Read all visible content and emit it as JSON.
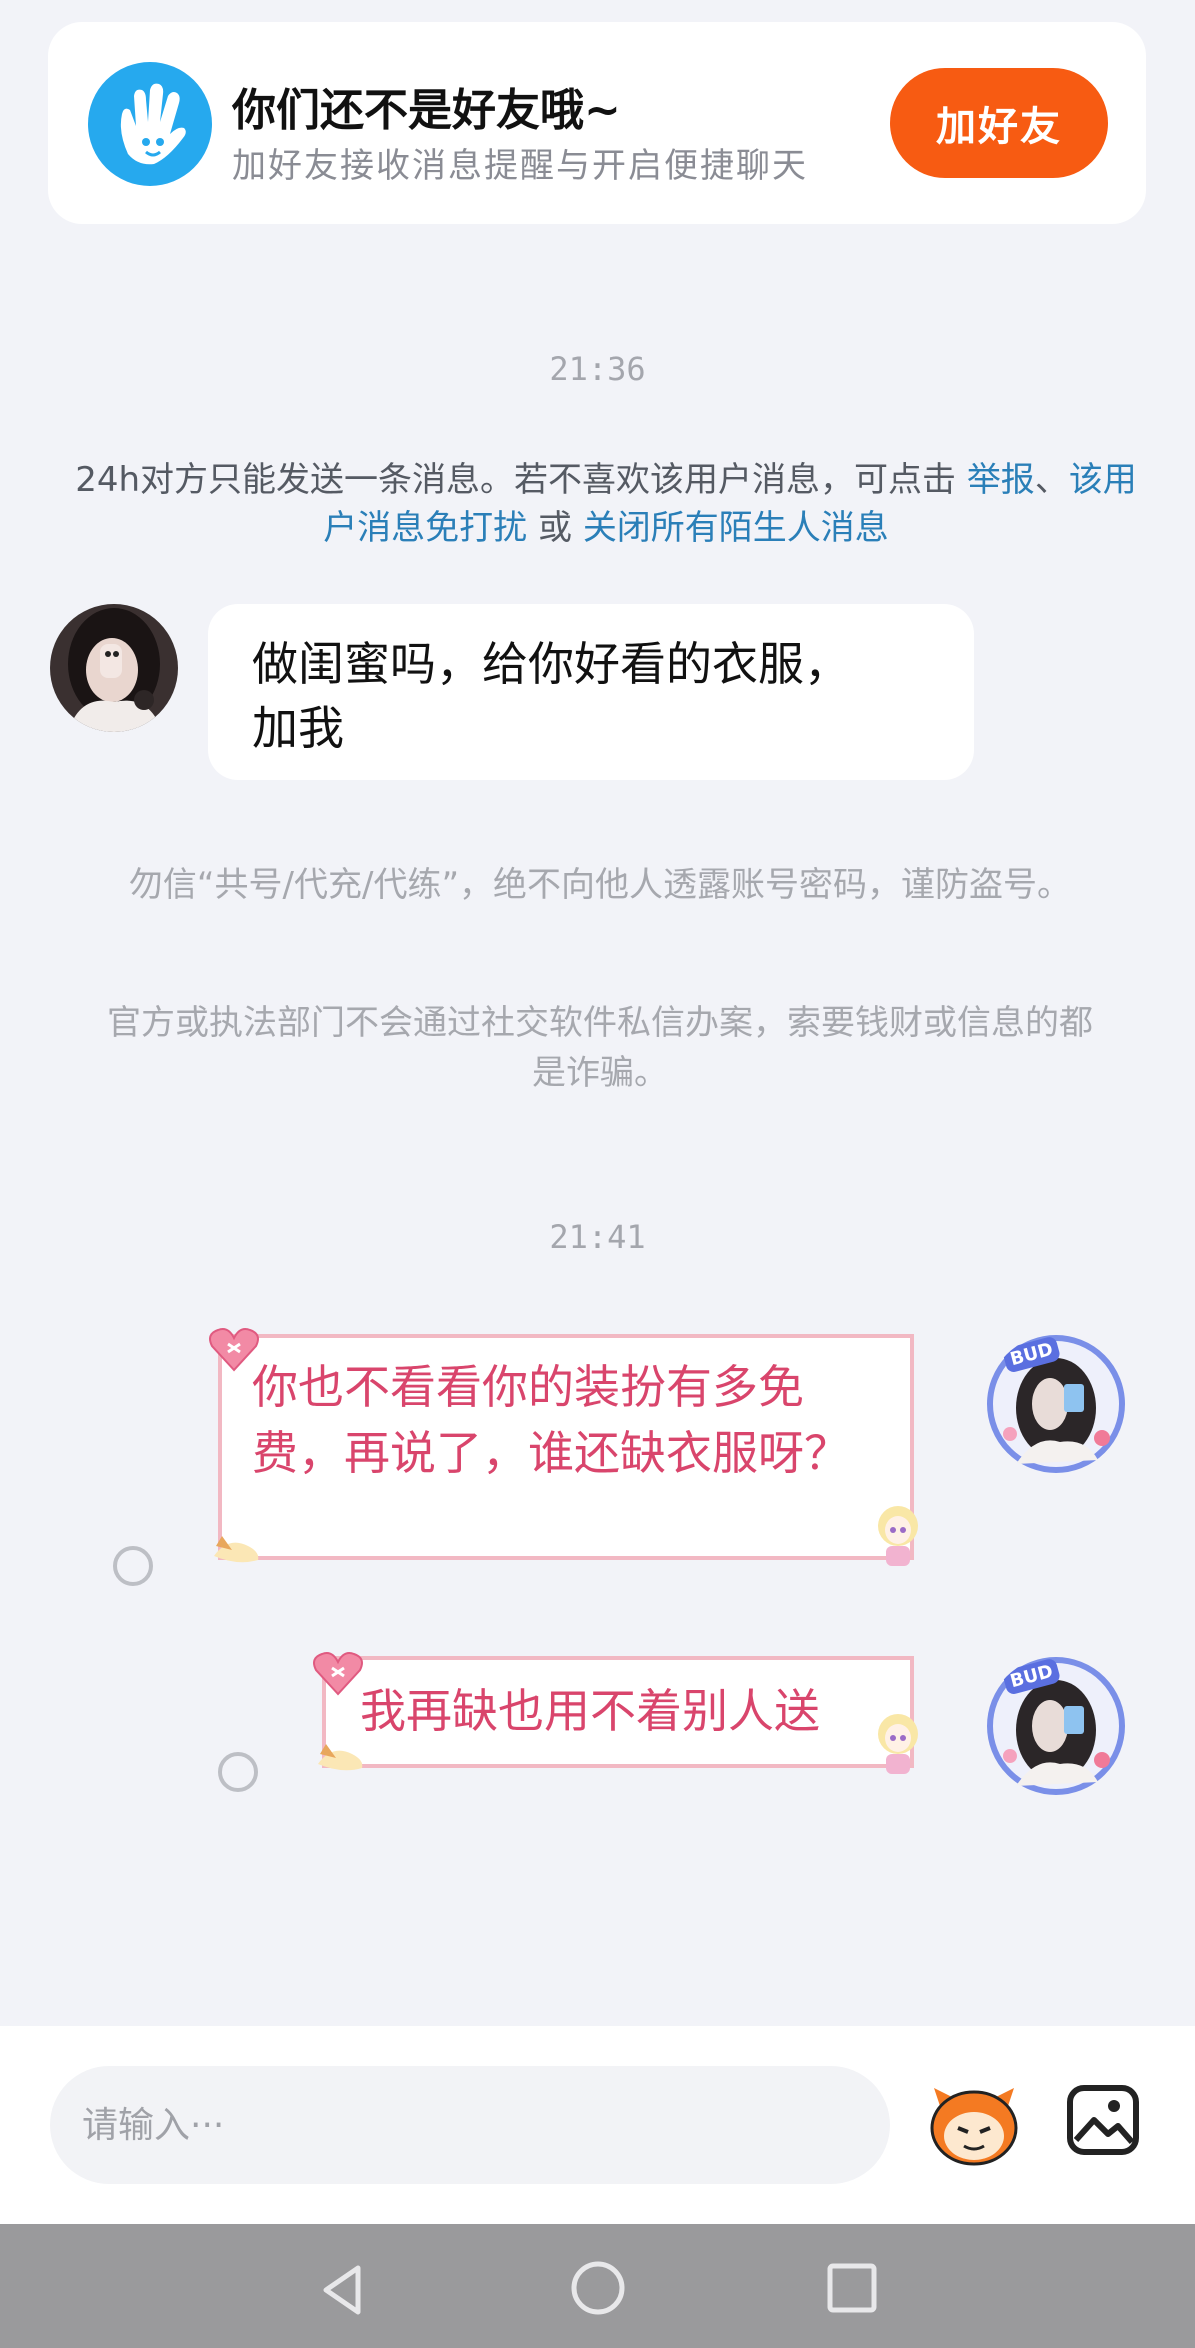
{
  "banner": {
    "title": "你们还不是好友哦~",
    "subtitle": "加好友接收消息提醒与开启便捷聊天",
    "add_button": "加好友"
  },
  "messages": {
    "time1": "21:36",
    "notice_text": "24h对方只能发送一条消息。若不喜欢该用户消息，可点击 ",
    "notice_link1": "举报",
    "notice_sep1": "、",
    "notice_link2": "该用户消息免打扰",
    "notice_sep2": " 或 ",
    "notice_link3": "关闭所有陌生人消息",
    "incoming_line1": "做闺蜜吗，给你好看的衣服，",
    "incoming_line2": "加我",
    "warning1": "勿信“共号/代充/代练”，绝不向他人透露账号密码，谨防盗号。",
    "warning2": "官方或执法部门不会通过社交软件私信办案，索要钱财或信息的都是诈骗。",
    "time2": "21:41",
    "outgoing1": "你也不看看你的装扮有多免费，再说了，谁还缺衣服呀？",
    "outgoing2": "我再缺也用不着别人送",
    "avatar_badge": "BUD"
  },
  "input": {
    "placeholder": "请输入···"
  },
  "icons": {
    "friend": "hand-wave-icon",
    "emoji": "emoji-mascot-icon",
    "image": "image-picker-icon",
    "back": "nav-back-icon",
    "home": "nav-home-icon",
    "recent": "nav-recent-icon"
  },
  "colors": {
    "accent": "#f75b12",
    "link": "#2a7fb8",
    "bubble_text": "#d9456c",
    "icon_blue": "#26a9ee"
  }
}
